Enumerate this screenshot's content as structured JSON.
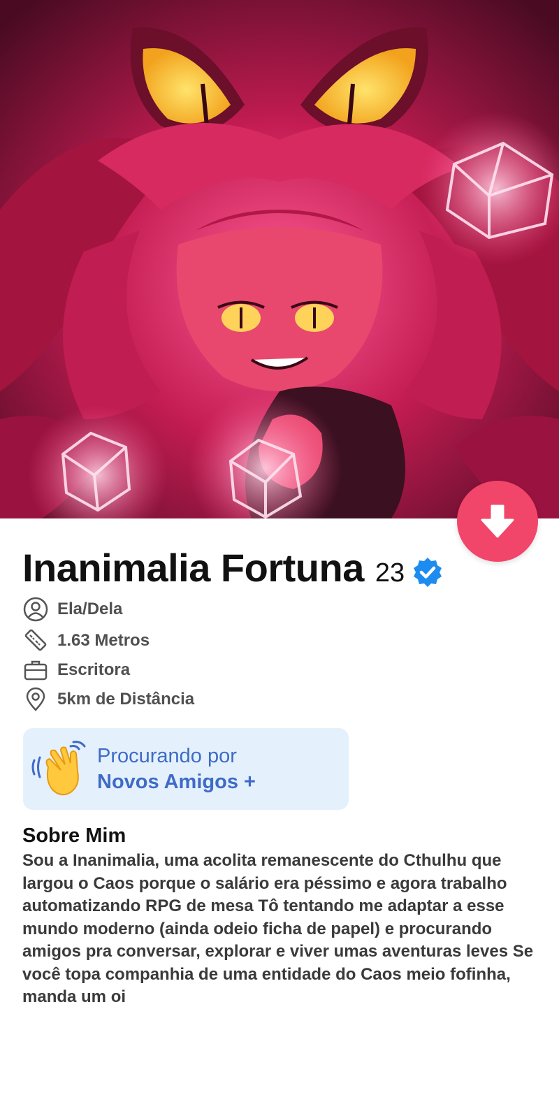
{
  "profile": {
    "name": "Inanimalia Fortuna",
    "age": "23",
    "verified": true,
    "photo_description_icon": "profile-photo",
    "details": [
      {
        "icon": "user-circle-icon",
        "text": "Ela/Dela"
      },
      {
        "icon": "ruler-icon",
        "text": "1.63 Metros"
      },
      {
        "icon": "briefcase-icon",
        "text": "Escritora"
      },
      {
        "icon": "location-pin-icon",
        "text": "5km de Distância"
      }
    ]
  },
  "looking_for": {
    "icon": "waving-hand-icon",
    "line1": "Procurando por",
    "line2": "Novos Amigos +"
  },
  "about": {
    "title": "Sobre Mim",
    "text": "Sou a Inanimalia, uma acolita remanescente do Cthulhu que largou o Caos porque o salário era péssimo e agora trabalho automatizando RPG de mesa  Tô tentando me adaptar a esse mundo moderno (ainda odeio ficha de papel) e procurando amigos pra conversar, explorar e viver umas aventuras leves  Se você topa companhia de uma entidade do Caos meio fofinha, manda um oi"
  },
  "colors": {
    "accent": "#f2456a",
    "verified": "#1d8cf0",
    "looking_bg": "#e4f1fd",
    "looking_text": "#3f6bc6"
  }
}
